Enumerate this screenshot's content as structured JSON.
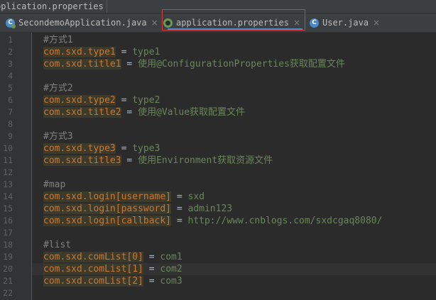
{
  "breadcrumb": {
    "label": "pplication.properties"
  },
  "tabs": [
    {
      "label": "SecondemoApplication.java",
      "icon": "spring-class-icon",
      "active": false
    },
    {
      "label": "application.properties",
      "icon": "spring-leaf-icon",
      "active": true
    },
    {
      "label": "User.java",
      "icon": "class-icon",
      "active": false
    }
  ],
  "tab_close_glyph": "×",
  "colors": {
    "key": "#cc7832",
    "value": "#6a8759",
    "comment": "#808080",
    "highlight_box": "#d83b3b",
    "active_tab_underline": "#4a88c7"
  },
  "editor": {
    "current_line": 20,
    "lines": [
      {
        "num": "1",
        "comment": "#方式1"
      },
      {
        "num": "2",
        "key": "com.sxd.type1",
        "sep": " = ",
        "value": "type1"
      },
      {
        "num": "3",
        "key": "com.sxd.title1",
        "sep": " = ",
        "value": "使用@ConfigurationProperties获取配置文件"
      },
      {
        "num": "4"
      },
      {
        "num": "5",
        "comment": "#方式2"
      },
      {
        "num": "6",
        "key": "com.sxd.type2",
        "sep": " = ",
        "value": "type2"
      },
      {
        "num": "7",
        "key": "com.sxd.title2",
        "sep": " = ",
        "value": "使用@Value获取配置文件"
      },
      {
        "num": "8"
      },
      {
        "num": "9",
        "comment": "#方式3"
      },
      {
        "num": "10",
        "key": "com.sxd.type3",
        "sep": " = ",
        "value": "type3"
      },
      {
        "num": "11",
        "key": "com.sxd.title3",
        "sep": " = ",
        "value": "使用Environment获取资源文件"
      },
      {
        "num": "12"
      },
      {
        "num": "13",
        "comment": "#map"
      },
      {
        "num": "14",
        "key": "com.sxd.login[username]",
        "sep": " = ",
        "value": "sxd"
      },
      {
        "num": "15",
        "key": "com.sxd.login[password]",
        "sep": " = ",
        "value": "admin123"
      },
      {
        "num": "16",
        "key": "com.sxd.login[callback]",
        "sep": " = ",
        "value": "http://www.cnblogs.com/sxdcgaq8080/"
      },
      {
        "num": "17"
      },
      {
        "num": "18",
        "comment": "#list"
      },
      {
        "num": "19",
        "key": "com.sxd.comList[0]",
        "sep": " = ",
        "value": "com1"
      },
      {
        "num": "20",
        "key": "com.sxd.comList[1]",
        "sep": " = ",
        "value": "com2"
      },
      {
        "num": "21",
        "key": "com.sxd.comList[2]",
        "sep": " = ",
        "value": "com3"
      },
      {
        "num": "22"
      }
    ]
  }
}
